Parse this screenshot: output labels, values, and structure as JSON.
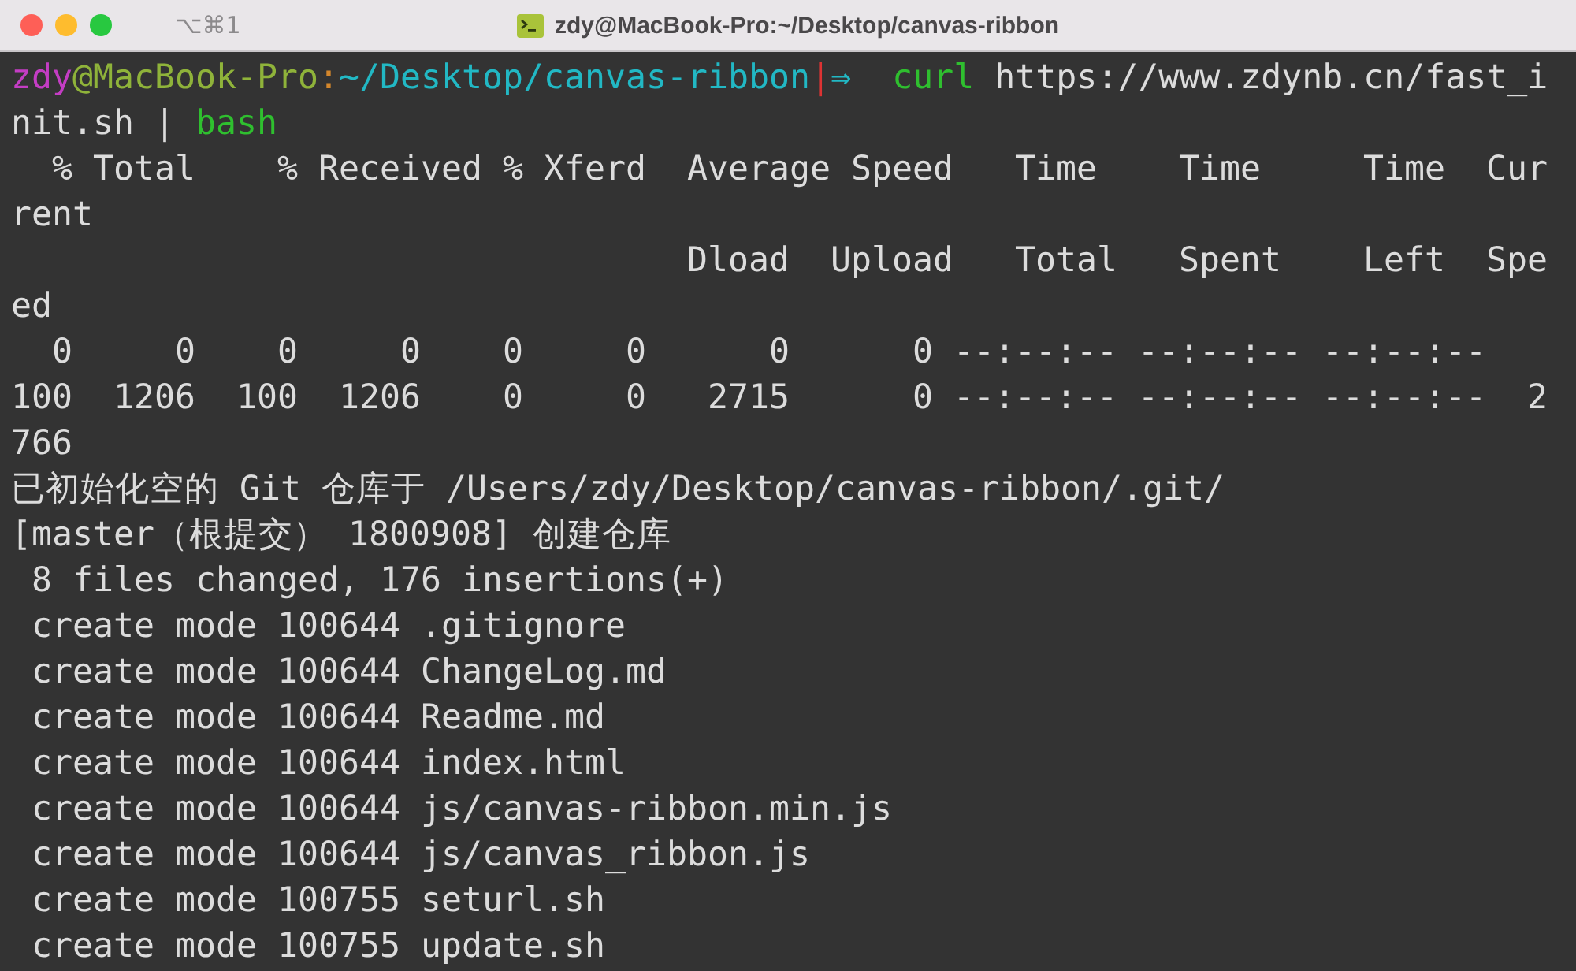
{
  "window": {
    "shortcut": "⌥⌘1",
    "title": "zdy@MacBook-Pro:~/Desktop/canvas-ribbon"
  },
  "lines": [
    {
      "segments": [
        {
          "kind": "user",
          "text": "zdy"
        },
        {
          "kind": "host",
          "text": "@MacBook-Pro"
        },
        {
          "kind": "colon",
          "text": ":"
        },
        {
          "kind": "path",
          "text": "~/Desktop/canvas-ribbon"
        },
        {
          "kind": "marker",
          "text": "|"
        },
        {
          "kind": "arrow",
          "text": "⇒  "
        },
        {
          "kind": "command",
          "text": "curl"
        },
        {
          "kind": "plain",
          "text": " https://www.zdynb.cn/fast_i"
        }
      ]
    },
    {
      "segments": [
        {
          "kind": "plain",
          "text": "nit.sh | "
        },
        {
          "kind": "command",
          "text": "bash"
        }
      ]
    },
    {
      "text": "  % Total    % Received % Xferd  Average Speed   Time    Time     Time  Cur"
    },
    {
      "text": "rent"
    },
    {
      "text": "                                 Dload  Upload   Total   Spent    Left  Spe"
    },
    {
      "text": "ed"
    },
    {
      "text": "  0     0    0     0    0     0      0      0 --:--:-- --:--:-- --:--:--"
    },
    {
      "text": "100  1206  100  1206    0     0   2715      0 --:--:-- --:--:-- --:--:--  2"
    },
    {
      "text": "766"
    },
    {
      "text": "已初始化空的 Git 仓库于 /Users/zdy/Desktop/canvas-ribbon/.git/"
    },
    {
      "text": "[master（根提交） 1800908] 创建仓库"
    },
    {
      "text": " 8 files changed, 176 insertions(+)"
    },
    {
      "text": " create mode 100644 .gitignore"
    },
    {
      "text": " create mode 100644 ChangeLog.md"
    },
    {
      "text": " create mode 100644 Readme.md"
    },
    {
      "text": " create mode 100644 index.html"
    },
    {
      "text": " create mode 100644 js/canvas-ribbon.min.js"
    },
    {
      "text": " create mode 100644 js/canvas_ribbon.js"
    },
    {
      "text": " create mode 100755 seturl.sh"
    },
    {
      "text": " create mode 100755 update.sh"
    }
  ]
}
